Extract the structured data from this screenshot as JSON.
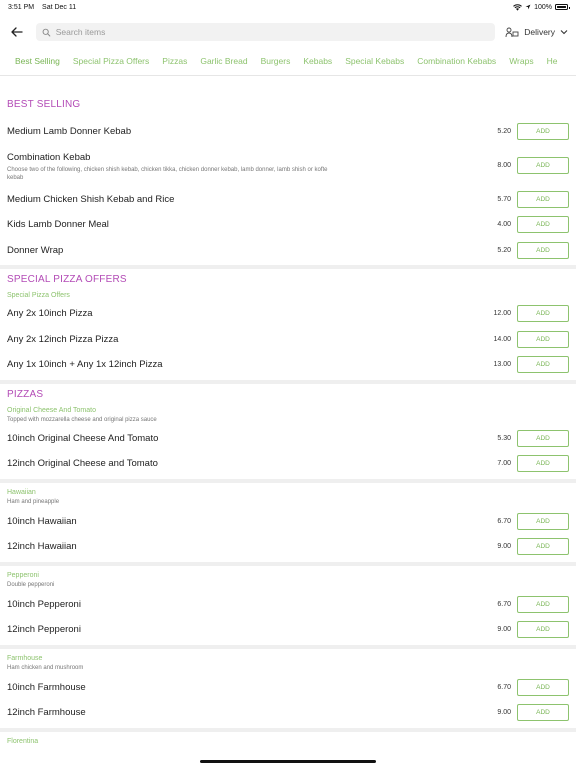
{
  "status": {
    "time": "3:51 PM",
    "date": "Sat Dec 11",
    "battery": "100%"
  },
  "search": {
    "placeholder": "Search items"
  },
  "delivery": {
    "label": "Delivery"
  },
  "tabs": [
    "Best Selling",
    "Special Pizza Offers",
    "Pizzas",
    "Garlic Bread",
    "Burgers",
    "Kebabs",
    "Special Kebabs",
    "Combination Kebabs",
    "Wraps",
    "He"
  ],
  "add_label": "ADD",
  "best_selling": {
    "title": "BEST SELLING",
    "items": [
      {
        "name": "Medium Lamb Donner Kebab",
        "price": "5.20"
      },
      {
        "name": "Combination Kebab",
        "desc": "Choose two of the following, chicken shish kebab, chicken tikka, chicken donner kebab, lamb donner, lamb shish or kofte kebab",
        "price": "8.00"
      },
      {
        "name": "Medium Chicken Shish Kebab and Rice",
        "price": "5.70"
      },
      {
        "name": "Kids Lamb Donner Meal",
        "price": "4.00"
      },
      {
        "name": "Donner Wrap",
        "price": "5.20"
      }
    ]
  },
  "special_pizza": {
    "title": "SPECIAL PIZZA OFFERS",
    "subtitle": "Special Pizza Offers",
    "items": [
      {
        "name": "Any 2x 10inch Pizza",
        "price": "12.00"
      },
      {
        "name": "Any 2x 12inch Pizza Pizza",
        "price": "14.00"
      },
      {
        "name": "Any 1x 10inch + Any 1x 12inch Pizza",
        "price": "13.00"
      }
    ]
  },
  "pizzas": {
    "title": "PIZZAS",
    "groups": [
      {
        "subtitle": "Original Cheese And Tomato",
        "desc": "Topped with mozzarella cheese and original pizza sauce",
        "items": [
          {
            "name": "10inch Original Cheese And Tomato",
            "price": "5.30"
          },
          {
            "name": "12inch Original Cheese and Tomato",
            "price": "7.00"
          }
        ]
      },
      {
        "subtitle": "Hawaiian",
        "desc": "Ham and pineapple",
        "items": [
          {
            "name": "10inch Hawaiian",
            "price": "6.70"
          },
          {
            "name": "12inch Hawaiian",
            "price": "9.00"
          }
        ]
      },
      {
        "subtitle": "Pepperoni",
        "desc": "Double pepperoni",
        "items": [
          {
            "name": "10inch Pepperoni",
            "price": "6.70"
          },
          {
            "name": "12inch Pepperoni",
            "price": "9.00"
          }
        ]
      },
      {
        "subtitle": "Farmhouse",
        "desc": "Ham chicken and mushroom",
        "items": [
          {
            "name": "10inch Farmhouse",
            "price": "6.70"
          },
          {
            "name": "12inch Farmhouse",
            "price": "9.00"
          }
        ]
      },
      {
        "subtitle": "Florentina"
      }
    ]
  }
}
